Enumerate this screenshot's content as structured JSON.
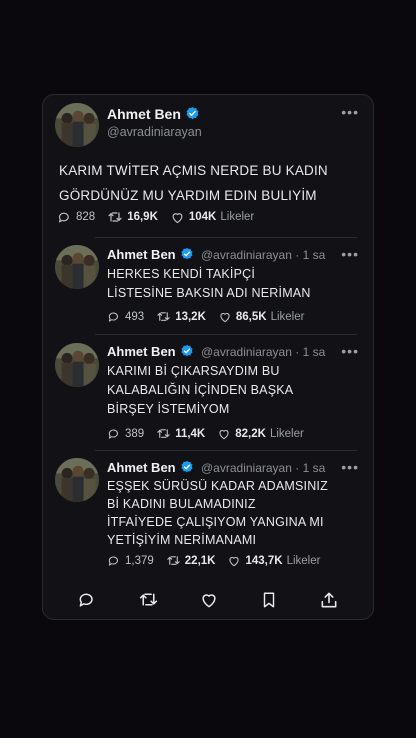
{
  "main": {
    "name": "Ahmet Ben",
    "handle": "@avradiniarayan",
    "text": "KARIM TWİTER AÇMIS NERDE BU KADIN\nGÖRDÜNÜZ MU YARDIM EDIN BULIYİM",
    "replies": "828",
    "retweets": "16,9K",
    "likes": "104K",
    "likes_label": "Likeler"
  },
  "replies": [
    {
      "name": "Ahmet Ben",
      "handle": "@avradiniarayan",
      "time": "· 1 sa",
      "text": "HERKES KENDİ TAKİPÇİ\nLİSTESİNE BAKSIN ADI NERİMAN",
      "replies": "493",
      "retweets": "13,2K",
      "likes": "86,5K",
      "likes_label": "Likeler"
    },
    {
      "name": "Ahmet Ben",
      "handle": "@avradiniarayan",
      "time": "· 1 sa",
      "text": "KARIMI Bİ ÇIKARSAYDIM BU\nKALABALIĞIN İÇİNDEN BAŞKA\nBİRŞEY İSTEMİYOM",
      "replies": "389",
      "retweets": "11,4K",
      "likes": "82,2K",
      "likes_label": "Likeler"
    },
    {
      "name": "Ahmet Ben",
      "handle": "@avradiniarayan",
      "time": "· 1 sa",
      "text": "EŞŞEK SÜRÜSÜ KADAR ADAMSINIZ\nBİ KADINI BULAMADINIZ\nİTFAİYEDE ÇALIŞIYOM YANGINA MI\nYETİŞİYİM NERİMANAMI",
      "replies": "1,379",
      "retweets": "22,1K",
      "likes": "143,7K",
      "likes_label": "Likeler"
    }
  ],
  "more_glyph": "•••",
  "icons": {
    "verified": "verified-badge-icon",
    "reply": "reply-icon",
    "retweet": "retweet-icon",
    "like": "heart-icon",
    "bookmark": "bookmark-icon",
    "share": "share-icon"
  },
  "colors": {
    "background": "#0a080c",
    "card": "#121116",
    "verified": "#1d9bf0",
    "muted": "#8b8f96"
  }
}
